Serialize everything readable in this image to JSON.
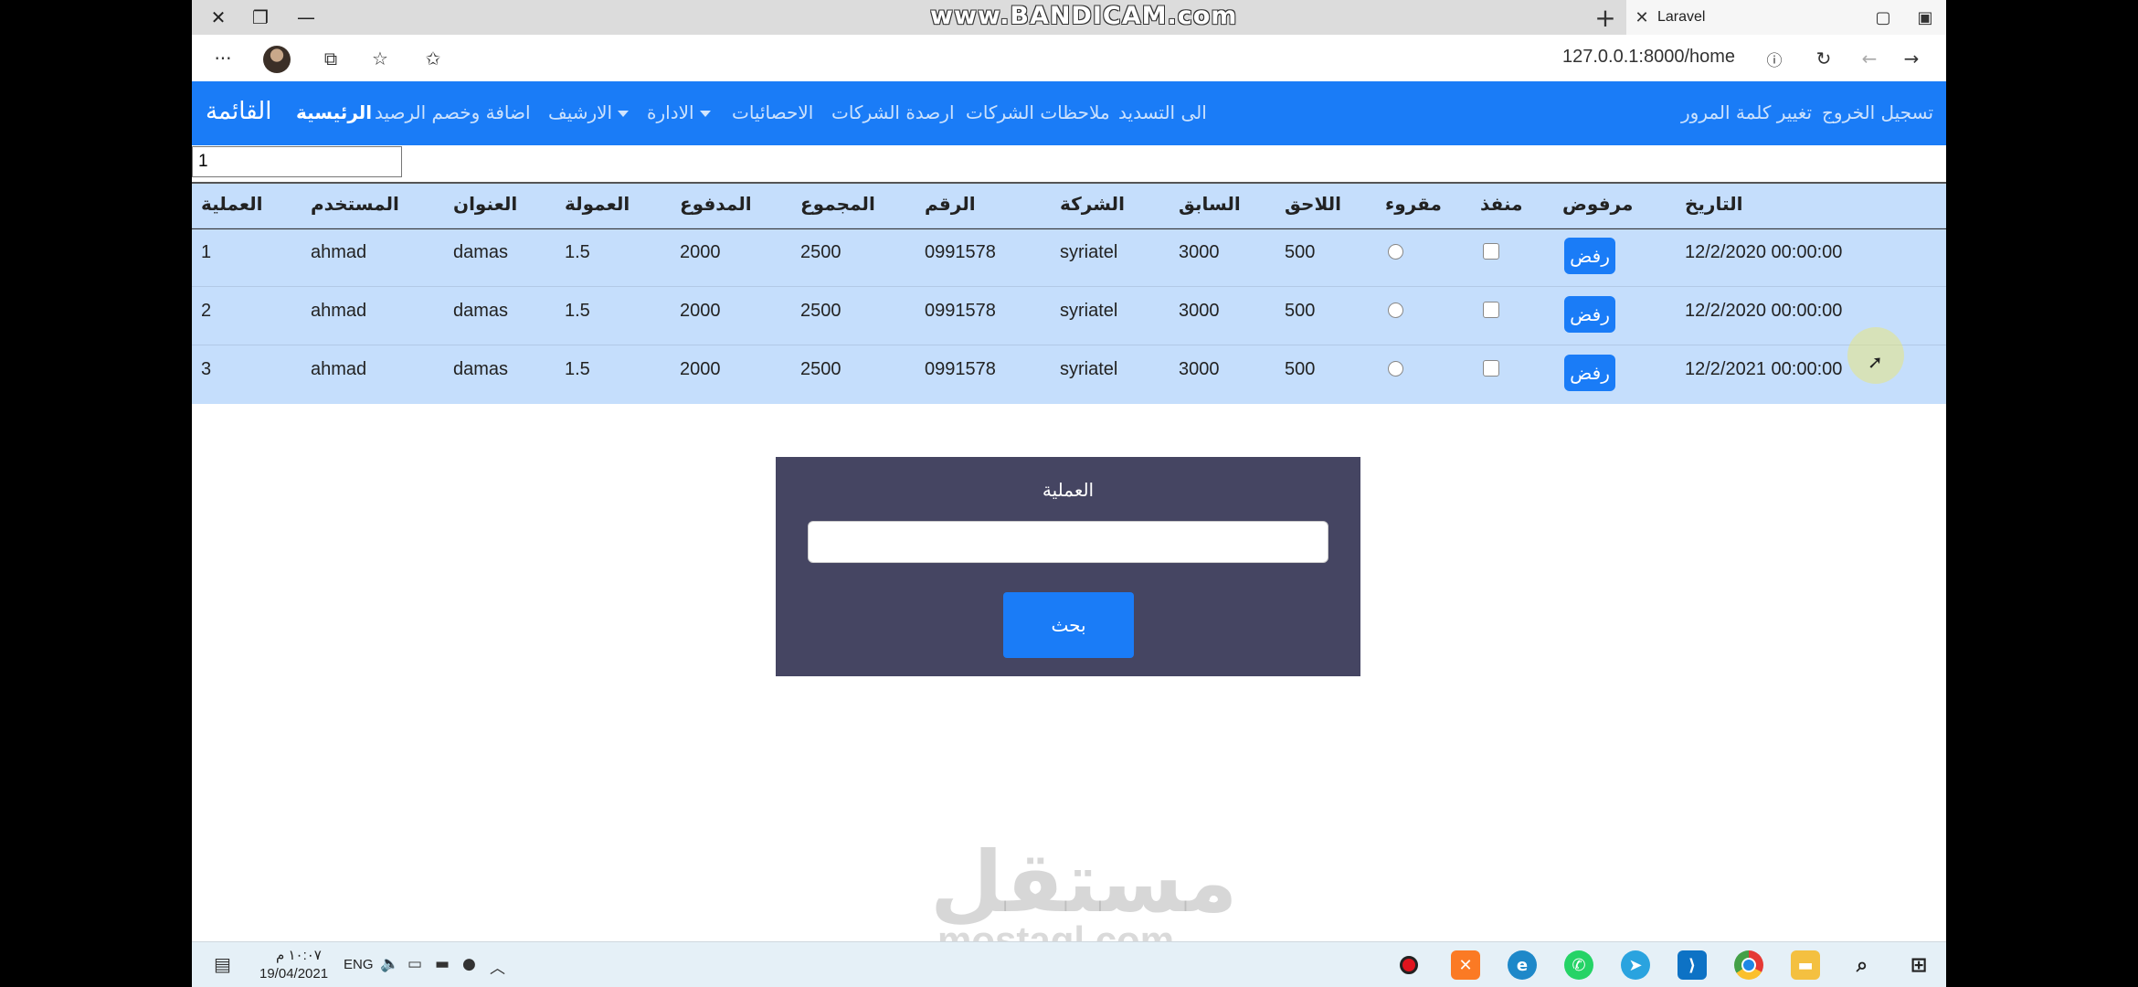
{
  "watermark": {
    "top": "www.BANDICAM.com",
    "bottom_ar": "مستقل",
    "bottom_en": "mostaql.com"
  },
  "browser": {
    "tab_title": "Laravel",
    "url": "127.0.0.1:8000/home",
    "new_tab_symbol": "+"
  },
  "navbar": {
    "brand": "القائمة",
    "links": [
      "الرئيسية",
      "اضافة وخصم الرصيد",
      "الارشيف",
      "الادارة",
      "الاحصائيات",
      "ارصدة الشركات",
      "ملاحظات الشركات",
      "الى التسديد"
    ],
    "right_links": [
      "تغيير كلمة المرور",
      "تسجيل الخروج"
    ]
  },
  "filter_value": "1",
  "table": {
    "headers": [
      "العملية",
      "المستخدم",
      "العنوان",
      "العمولة",
      "المدفوع",
      "المجموع",
      "الرقم",
      "الشركة",
      "السابق",
      "اللاحق",
      "مقروء",
      "منفذ",
      "مرفوض",
      "التاريخ"
    ],
    "reject_label": "رفض",
    "rows": [
      {
        "op": "1",
        "user": "ahmad",
        "address": "damas",
        "commission": "1.5",
        "paid": "2000",
        "total": "2500",
        "number": "0991578",
        "company": "syriatel",
        "previous": "3000",
        "next": "500",
        "date": "12/2/2020 00:00:00"
      },
      {
        "op": "2",
        "user": "ahmad",
        "address": "damas",
        "commission": "1.5",
        "paid": "2000",
        "total": "2500",
        "number": "0991578",
        "company": "syriatel",
        "previous": "3000",
        "next": "500",
        "date": "12/2/2020 00:00:00"
      },
      {
        "op": "3",
        "user": "ahmad",
        "address": "damas",
        "commission": "1.5",
        "paid": "2000",
        "total": "2500",
        "number": "0991578",
        "company": "syriatel",
        "previous": "3000",
        "next": "500",
        "date": "12/2/2021 00:00:00"
      }
    ]
  },
  "search": {
    "label": "العملية",
    "button": "بحث"
  },
  "taskbar": {
    "time": "١٠:٠٧ م",
    "date": "19/04/2021",
    "lang": "ENG"
  },
  "colors": {
    "primary": "#1a7cf7",
    "table_bg": "#c5defc",
    "panel_bg": "#454562"
  }
}
